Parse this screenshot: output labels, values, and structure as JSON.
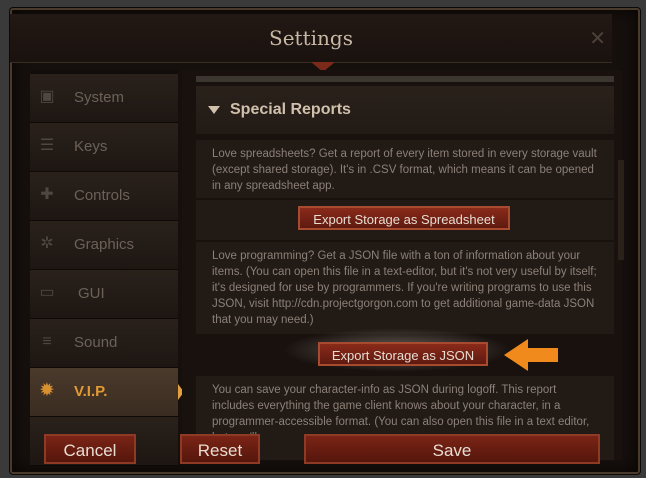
{
  "window": {
    "title": "Settings"
  },
  "sidebar": {
    "items": [
      {
        "label": "System",
        "icon": "system-icon"
      },
      {
        "label": "Keys",
        "icon": "keys-icon"
      },
      {
        "label": "Controls",
        "icon": "controls-icon"
      },
      {
        "label": "Graphics",
        "icon": "graphics-icon"
      },
      {
        "label": "GUI",
        "icon": "gui-icon"
      },
      {
        "label": "Sound",
        "icon": "sound-icon"
      },
      {
        "label": "V.I.P.",
        "icon": "vip-badge-icon",
        "active": true
      }
    ]
  },
  "main": {
    "section_title": "Special Reports",
    "para1": "Love spreadsheets? Get a report of every item stored in every storage vault (except shared storage). It's in .CSV format, which means it can be opened in any spreadsheet app.",
    "export_csv_label": "Export Storage as Spreadsheet",
    "para2": "Love programming? Get a JSON file with a ton of information about your items. (You can open this file in a text-editor, but it's not very useful by itself; it's designed for use by programmers. If you're writing programs to use this JSON, visit http://cdn.projectgorgon.com to get additional game-data JSON that you may need.)",
    "export_json_label": "Export Storage as JSON",
    "para3": "You can save your character-info as JSON during logoff. This report includes everything the game client knows about your character, in a programmer-accessible format. (You can also open this file in a text editor, but you'll"
  },
  "footer": {
    "cancel_label": "Cancel",
    "reset_label": "Reset",
    "save_label": "Save"
  },
  "colors": {
    "accent": "#e29a33",
    "button_red": "#7a2416",
    "highlight_arrow": "#f08a1c"
  }
}
